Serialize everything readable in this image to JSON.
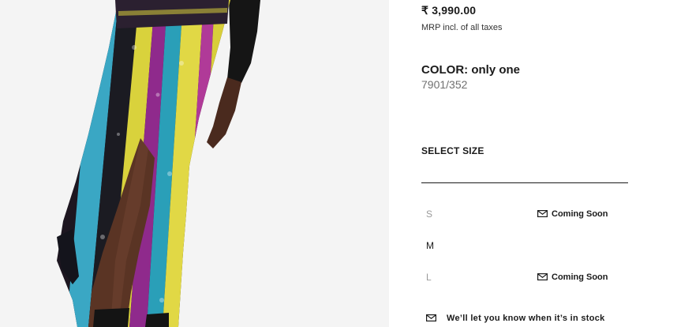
{
  "product": {
    "image_alt": "model wearing multicolour sequin midi skirt"
  },
  "price": {
    "amount": "₹ 3,990.00",
    "tax_note": "MRP incl. of all taxes"
  },
  "color": {
    "label": "COLOR: only one",
    "code": "7901/352"
  },
  "sizes": {
    "heading": "SELECT SIZE",
    "items": [
      {
        "label": "S",
        "status": "Coming Soon",
        "available": false
      },
      {
        "label": "M",
        "status": "",
        "available": true
      },
      {
        "label": "L",
        "status": "Coming Soon",
        "available": false
      }
    ]
  },
  "notify": {
    "label": "We’ll let you know when it’s in stock"
  },
  "icons": {
    "mail": "mail-icon"
  },
  "colors": {
    "text": "#1a1a1a",
    "muted": "#9a9a9a",
    "code_gray": "#707070"
  }
}
